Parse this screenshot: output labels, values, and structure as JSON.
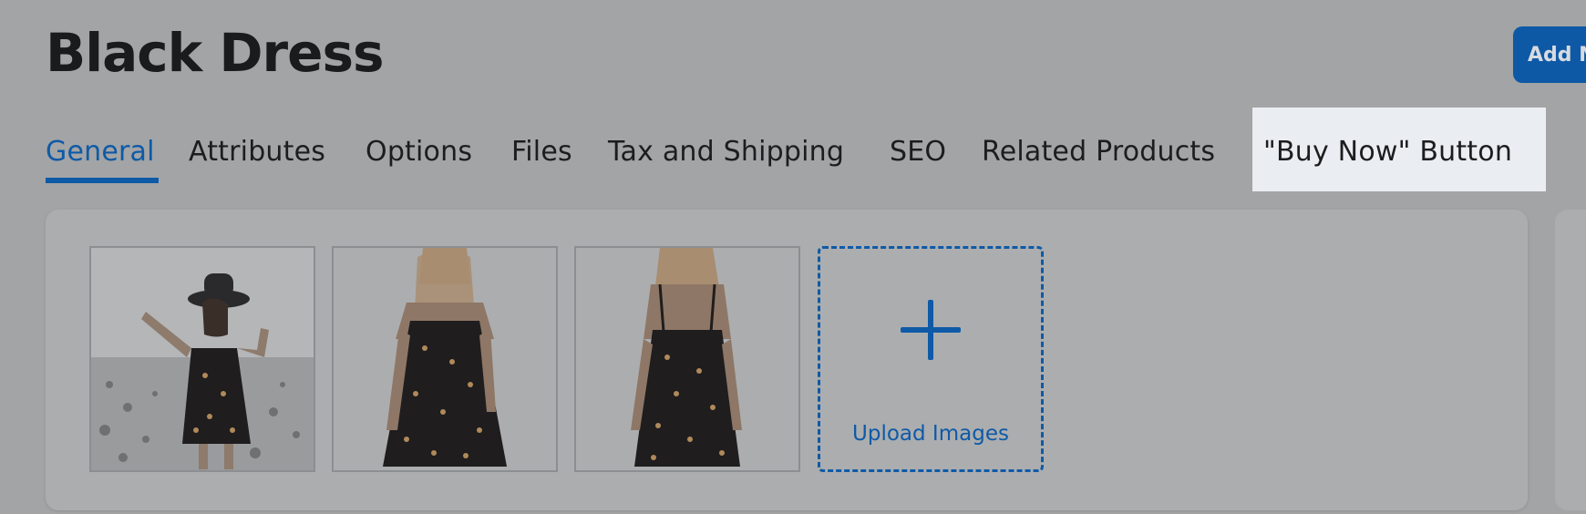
{
  "page": {
    "title": "Black Dress",
    "add_button_label": "Add N"
  },
  "tabs": [
    {
      "label": "General",
      "active": true
    },
    {
      "label": "Attributes",
      "active": false
    },
    {
      "label": "Options",
      "active": false
    },
    {
      "label": "Files",
      "active": false
    },
    {
      "label": "Tax and Shipping",
      "active": false
    },
    {
      "label": "SEO",
      "active": false
    },
    {
      "label": "Related Products",
      "active": false
    },
    {
      "label": "\"Buy Now\" Button",
      "active": false,
      "highlighted": true
    }
  ],
  "gallery": {
    "images": [
      {
        "description_icon": "product-photo-beach-icon"
      },
      {
        "description_icon": "product-photo-front-icon"
      },
      {
        "description_icon": "product-photo-back-icon"
      }
    ],
    "upload_label": "Upload Images"
  },
  "colors": {
    "accent": "#0e5aa7",
    "overlay_background": "#a3a4a6",
    "highlight": "#eaedf1"
  }
}
